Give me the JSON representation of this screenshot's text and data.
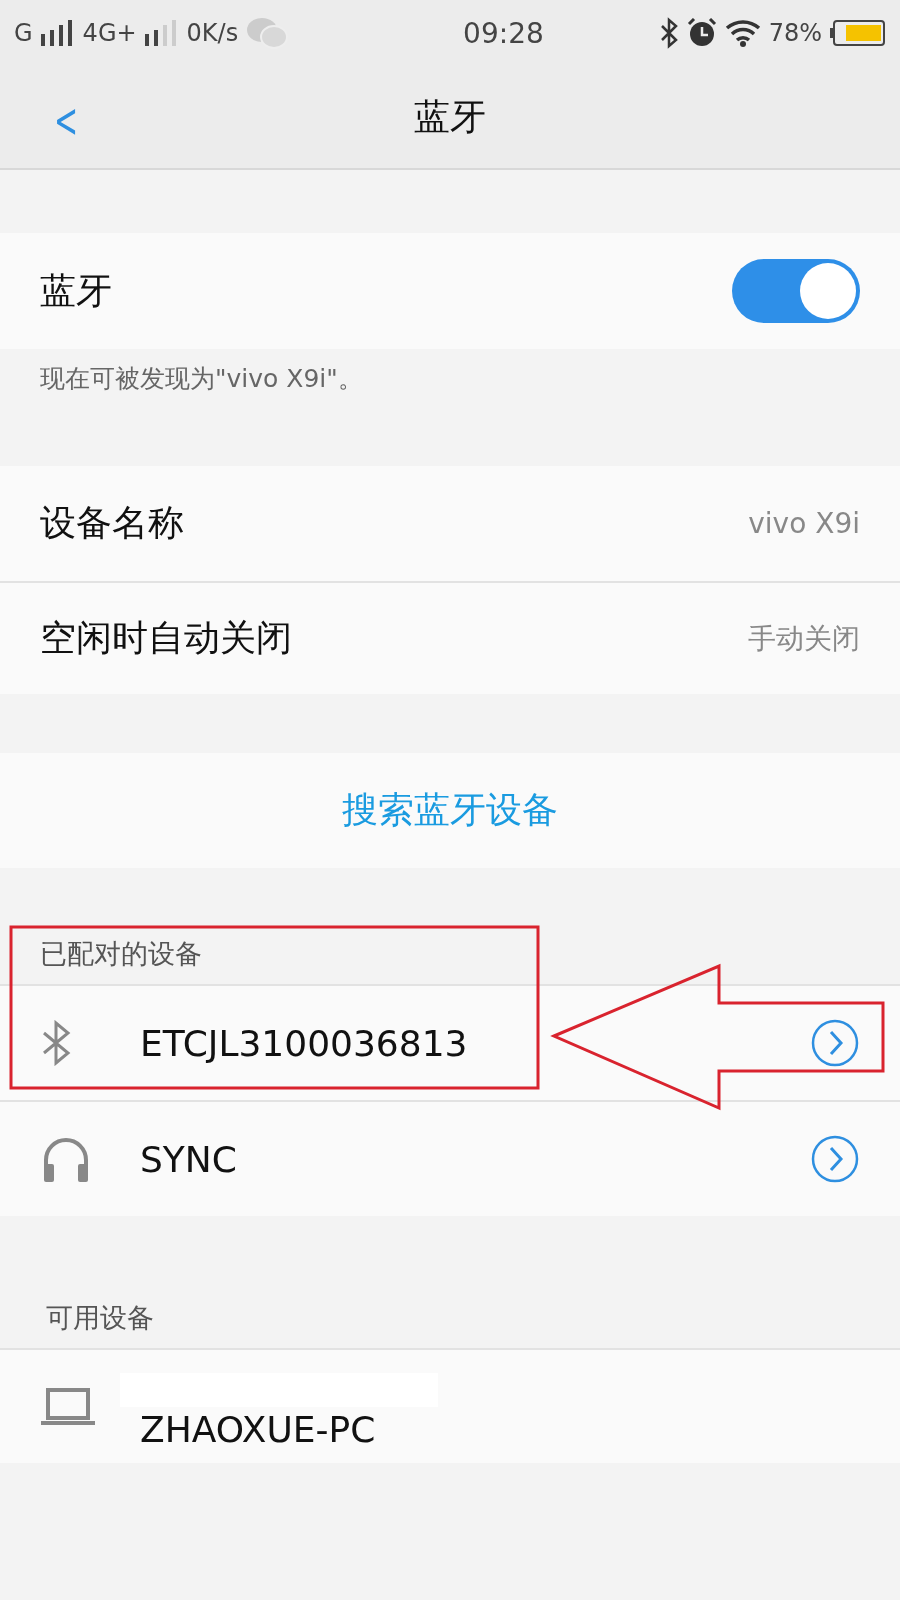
{
  "status_bar": {
    "network_1": "G",
    "network_2": "4G+",
    "speed": "0K/s",
    "time": "09:28",
    "battery": "78%"
  },
  "header": {
    "back": "<",
    "title": "蓝牙"
  },
  "bluetooth": {
    "label": "蓝牙",
    "on": true,
    "caption": "现在可被发现为\"vivo X9i\"。"
  },
  "settings": [
    {
      "label": "设备名称",
      "value": "vivo X9i"
    },
    {
      "label": "空闲时自动关闭",
      "value": "手动关闭"
    }
  ],
  "search_button": "搜索蓝牙设备",
  "paired": {
    "header": "已配对的设备",
    "devices": [
      {
        "kind": "bluetooth",
        "name": "ETCJL3100036813"
      },
      {
        "kind": "headphones",
        "name": "SYNC"
      }
    ]
  },
  "available": {
    "header": "可用设备",
    "devices": [
      {
        "kind": "laptop",
        "name": "ZHAOXUE-PC",
        "redacted": true
      }
    ]
  },
  "annotation": {
    "highlight": true,
    "arrow": true
  }
}
